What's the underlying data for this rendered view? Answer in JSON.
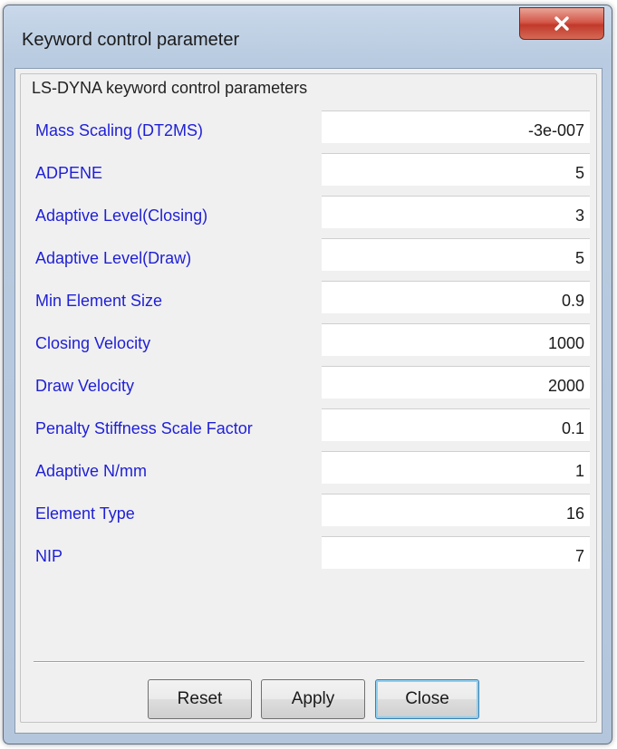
{
  "window": {
    "title": "Keyword control parameter",
    "close_icon": "close-icon"
  },
  "group": {
    "title": "LS-DYNA keyword control parameters"
  },
  "params": [
    {
      "label": "Mass Scaling (DT2MS)",
      "value": "-3e-007"
    },
    {
      "label": "ADPENE",
      "value": "5"
    },
    {
      "label": "Adaptive Level(Closing)",
      "value": "3"
    },
    {
      "label": "Adaptive Level(Draw)",
      "value": "5"
    },
    {
      "label": "Min Element Size",
      "value": "0.9"
    },
    {
      "label": "Closing Velocity",
      "value": "1000"
    },
    {
      "label": "Draw Velocity",
      "value": "2000"
    },
    {
      "label": "Penalty Stiffness Scale Factor",
      "value": "0.1"
    },
    {
      "label": "Adaptive N/mm",
      "value": "1"
    },
    {
      "label": "Element Type",
      "value": "16"
    },
    {
      "label": "NIP",
      "value": "7"
    }
  ],
  "buttons": {
    "reset": "Reset",
    "apply": "Apply",
    "close": "Close"
  },
  "colors": {
    "label": "#1f1fd6",
    "close_button": "#c2392b"
  }
}
